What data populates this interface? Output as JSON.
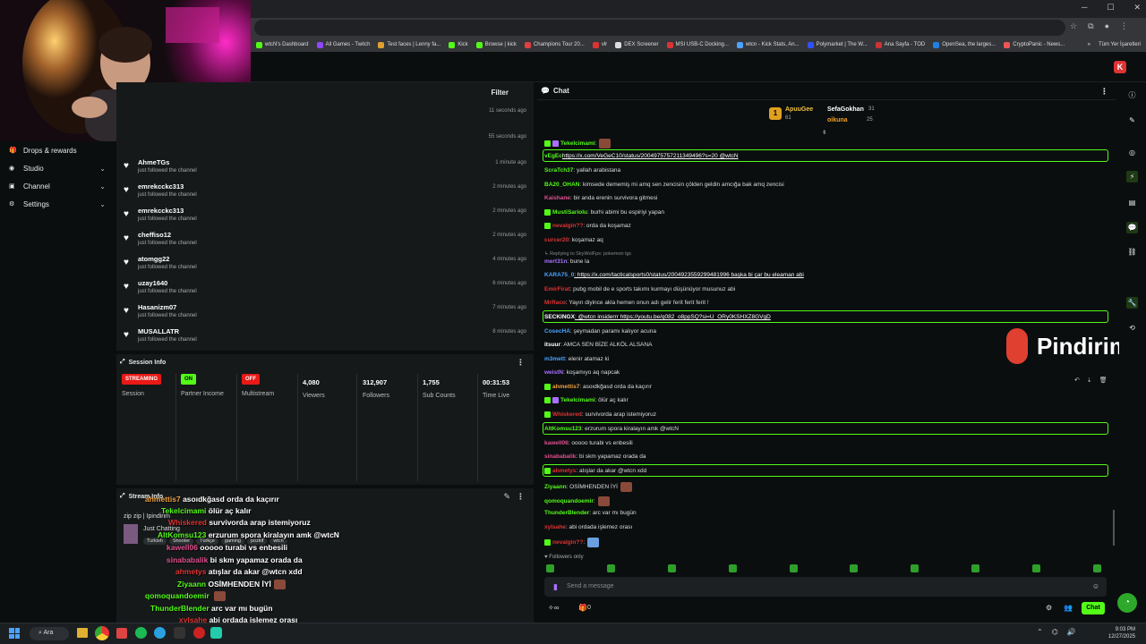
{
  "window": {
    "minimize": "─",
    "maximize": "☐",
    "close": "✕"
  },
  "bookmarks": [
    {
      "label": "wtcN's Dashboard",
      "color": "#53fc18"
    },
    {
      "label": "All Games - Twitch",
      "color": "#9146ff"
    },
    {
      "label": "Test faces | Lenny fa...",
      "color": "#e0a030"
    },
    {
      "label": "Kick",
      "color": "#53fc18"
    },
    {
      "label": "Browse | kick",
      "color": "#53fc18"
    },
    {
      "label": "Champions Tour 20...",
      "color": "#e04040"
    },
    {
      "label": "vlr",
      "color": "#d33"
    },
    {
      "label": "DEX Screener",
      "color": "#ddd"
    },
    {
      "label": "MSI USB-C Docking...",
      "color": "#d33"
    },
    {
      "label": "wtcn - Kick Stats, An...",
      "color": "#4aa3ff"
    },
    {
      "label": "Polymarket | The W...",
      "color": "#3050ff"
    },
    {
      "label": "Ana Sayfa - TOD",
      "color": "#c33"
    },
    {
      "label": "OpenSea, the larges...",
      "color": "#2081e2"
    },
    {
      "label": "CryptoPanic - News...",
      "color": "#e55"
    }
  ],
  "bookmarks_more": "»",
  "bookmarks_all": "Tüm Yer İşaretleri",
  "kick_logo": "K",
  "sidebar": [
    {
      "label": "Drops & rewards",
      "icon": "gift-icon",
      "glyph": "🎁",
      "chevron": ""
    },
    {
      "label": "Studio",
      "icon": "video-icon",
      "glyph": "◉",
      "chevron": "⌄"
    },
    {
      "label": "Channel",
      "icon": "tv-icon",
      "glyph": "▣",
      "chevron": "⌄"
    },
    {
      "label": "Settings",
      "icon": "gear-icon",
      "glyph": "⚙",
      "chevron": "⌄"
    }
  ],
  "followers": {
    "filter_label": "Filter",
    "rows": [
      {
        "name": "",
        "sub": "",
        "time": "11 seconds ago"
      },
      {
        "name": "",
        "sub": "",
        "time": "55 seconds ago"
      },
      {
        "name": "AhmeTGs",
        "sub": "just followed the channel",
        "time": "1 minute ago"
      },
      {
        "name": "emrekcckc313",
        "sub": "just followed the channel",
        "time": "2 minutes ago"
      },
      {
        "name": "emrekcckc313",
        "sub": "just followed the channel",
        "time": "2 minutes ago"
      },
      {
        "name": "cheffiso12",
        "sub": "just followed the channel",
        "time": "2 minutes ago"
      },
      {
        "name": "atomgg22",
        "sub": "just followed the channel",
        "time": "4 minutes ago"
      },
      {
        "name": "uzay1640",
        "sub": "just followed the channel",
        "time": "6 minutes ago"
      },
      {
        "name": "Hasanizm07",
        "sub": "just followed the channel",
        "time": "7 minutes ago"
      },
      {
        "name": "MUSALLATR",
        "sub": "just followed the channel",
        "time": "8 minutes ago"
      }
    ],
    "partial_sub": "just followed the channel"
  },
  "session": {
    "title": "Session Info",
    "streaming_badge": "STREAMING",
    "session_label": "Session",
    "partner_badge": "ON",
    "partner_label": "Partner Income",
    "multistream_badge": "OFF",
    "multistream_label": "Multistream",
    "viewers": "4,080",
    "viewers_label": "Viewers",
    "followers": "312,907",
    "followers_label": "Followers",
    "subs": "1,755",
    "subs_label": "Sub Counts",
    "time": "00:31:53",
    "time_label": "Time Live"
  },
  "streaminfo": {
    "title": "Stream Info",
    "stream_title": "zip zip | Ipindirim",
    "category": "Just Chatting",
    "tags": [
      "Turkish",
      "Shooter",
      "Türkçe",
      "gaming",
      "pozitif",
      "wtcn"
    ]
  },
  "overlay_chat": [
    {
      "user": "ahmettis7",
      "text": "asoıdkğasd orda da kaçırır",
      "color": "#f0a040"
    },
    {
      "user": "Tekelcimami",
      "text": "ölür aç kalır",
      "color": "#53fc18"
    },
    {
      "user": "Whiskered",
      "text": "survivorda arap istemiyoruz",
      "color": "#d33"
    },
    {
      "user": "AltKomsu123",
      "text": "erzurum spora kiralayın amk @wtcN",
      "color": "#53fc18"
    },
    {
      "user": "kawell06",
      "text": "ooooo turabi vs enbesili",
      "color": "#e05090"
    },
    {
      "user": "sinababalik",
      "text": "bi skm yapamaz orada da",
      "color": "#e05090"
    },
    {
      "user": "ahmetys",
      "text": "atışlar da akar @wtcn xdd",
      "color": "#d33"
    },
    {
      "user": "Ziyaann",
      "text": "OSİMHENDEN İYİ",
      "color": "#53fc18"
    },
    {
      "user": "qomoquandoemir",
      "text": "",
      "color": "#53fc18"
    },
    {
      "user": "ThunderBlender",
      "text": "arc var mı bugün",
      "color": "#53fc18"
    },
    {
      "user": "xylsahe",
      "text": "abi ordada işlemez orası",
      "color": "#d33"
    },
    {
      "user": "nevalgin??",
      "text": "",
      "color": "#d33"
    }
  ],
  "chat": {
    "title": "Chat",
    "pinned": [
      {
        "name": "ApuuGee",
        "count": "61"
      },
      {
        "name": "SefaGokhan",
        "count": "31"
      },
      {
        "name": "oikuna",
        "count": "25"
      }
    ],
    "messages": [
      {
        "user": "Tekelcimami",
        "text": ":",
        "color": "#53fc18"
      },
      {
        "user": "vEgEc",
        "text": "https://x.com/VeGeC10/status/2004975757211349496?s=20 @wtcN",
        "color": "#53fc18"
      },
      {
        "user": "ScraTch37",
        "text": ": yallah arabistana",
        "color": "#53fc18"
      },
      {
        "user": "BA20_OHAN",
        "text": ": kimsede dememiş mi amq sen zencisin çölden geldin amcığa bak amq zencisi",
        "color": "#53fc18"
      },
      {
        "user": "Kaishane",
        "text": ": bir anda erenin survivora gitmesi",
        "color": "#e05090"
      },
      {
        "user": "MustiSariolu",
        "text": ": burhi abimi bu espiriyi yapan",
        "color": "#53fc18"
      },
      {
        "user": "nevalgin??",
        "text": ": orda da koşamaz",
        "color": "#d33"
      },
      {
        "user": "curcer20",
        "text": ": koşamaz aq",
        "color": "#d33"
      },
      {
        "user": "↳ Replying to SkyWolFps: pokemon tgc",
        "text": "",
        "color": "#888"
      },
      {
        "user": "mert31n",
        "text": ": bune la",
        "color": "#a970ff"
      },
      {
        "user": "KARA75_0",
        "text": ": https://x.com/tacticalsports0/status/2004923559299481996 başka bi çar bu eleaman abi",
        "color": "#4aa3ff"
      },
      {
        "user": "EmirFirat",
        "text": ": pubg mobil de e sports takımı kurmayı düşünüyor musunuz abi",
        "color": "#d33"
      },
      {
        "user": "MrRaco",
        "text": ": Yayın diyince akla hemen onun adı gelir ferit ferit ferit !",
        "color": "#d33"
      },
      {
        "user": "SECKINGX",
        "text": ": @wtcn insiderrr https://youtu.be/q082_o8ppSQ?si=U_ORy0KSHXZ8GVgD",
        "color": "#fff"
      },
      {
        "user": "CosecHA",
        "text": ": şeymadan paramı kalıyor acuna",
        "color": "#4aa3ff"
      },
      {
        "user": "itsuur",
        "text": ": AMCA SEN BİZE ALKÖL ALSANA",
        "color": "#fff"
      },
      {
        "user": "m3mett",
        "text": ": elenir atamaz ki",
        "color": "#4aa3ff"
      },
      {
        "user": "weistN",
        "text": ": koşamıyo aq napcak",
        "color": "#a970ff"
      },
      {
        "user": "ahmettis7",
        "text": ": asoıdkğasd orda da kaçırır",
        "color": "#f0a040"
      },
      {
        "user": "Tekelcimami",
        "text": ": ölür aç kalır",
        "color": "#53fc18"
      },
      {
        "user": "Whiskered",
        "text": ": survivorda arap istemiyoruz",
        "color": "#d33"
      },
      {
        "user": "AltKomsu123",
        "text": ": erzurum spora kiralayın amk @wtcN",
        "color": "#53fc18"
      },
      {
        "user": "kawell06",
        "text": ": ooooo turabi vs enbesili",
        "color": "#e05090"
      },
      {
        "user": "sinababalik",
        "text": ": bi skm yapamaz orada da",
        "color": "#e05090"
      },
      {
        "user": "ahmetys",
        "text": ": atışlar da akar @wtcn xdd",
        "color": "#d33"
      },
      {
        "user": "Ziyaann",
        "text": ": OSİMHENDEN İYİ",
        "color": "#53fc18"
      },
      {
        "user": "qomoquandoemir",
        "text": ":",
        "color": "#53fc18"
      },
      {
        "user": "ThunderBlender",
        "text": ": arc var mı bugün",
        "color": "#53fc18"
      },
      {
        "user": "xylsahe",
        "text": ": abi ordada işlemez orası",
        "color": "#d33"
      },
      {
        "user": "nevalgin??",
        "text": ":",
        "color": "#d33"
      }
    ],
    "followers_only": "Followers only",
    "input_placeholder": "Send a message",
    "send_label": "Chat",
    "point_count": "0"
  },
  "pindirim_logo": "Pindirim",
  "taskbar": {
    "search": "Ara",
    "time": "9:03 PM",
    "date": "12/27/2025"
  }
}
